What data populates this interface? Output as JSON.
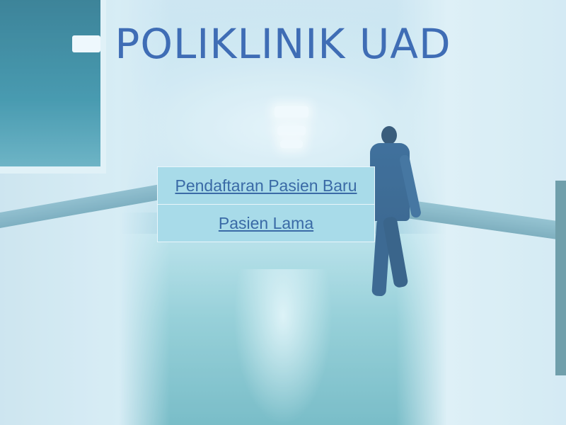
{
  "page": {
    "title": "POLIKLINIK UAD"
  },
  "menu": {
    "items": [
      {
        "label": "Pendaftaran Pasien Baru"
      },
      {
        "label": "Pasien Lama"
      }
    ]
  },
  "colors": {
    "title": "#3f6db5",
    "link": "#3a6aa6",
    "menu_background": "#a8dbe9",
    "menu_border": "#e9f6fb"
  },
  "background": {
    "image": "hospital-corridor-photo"
  }
}
